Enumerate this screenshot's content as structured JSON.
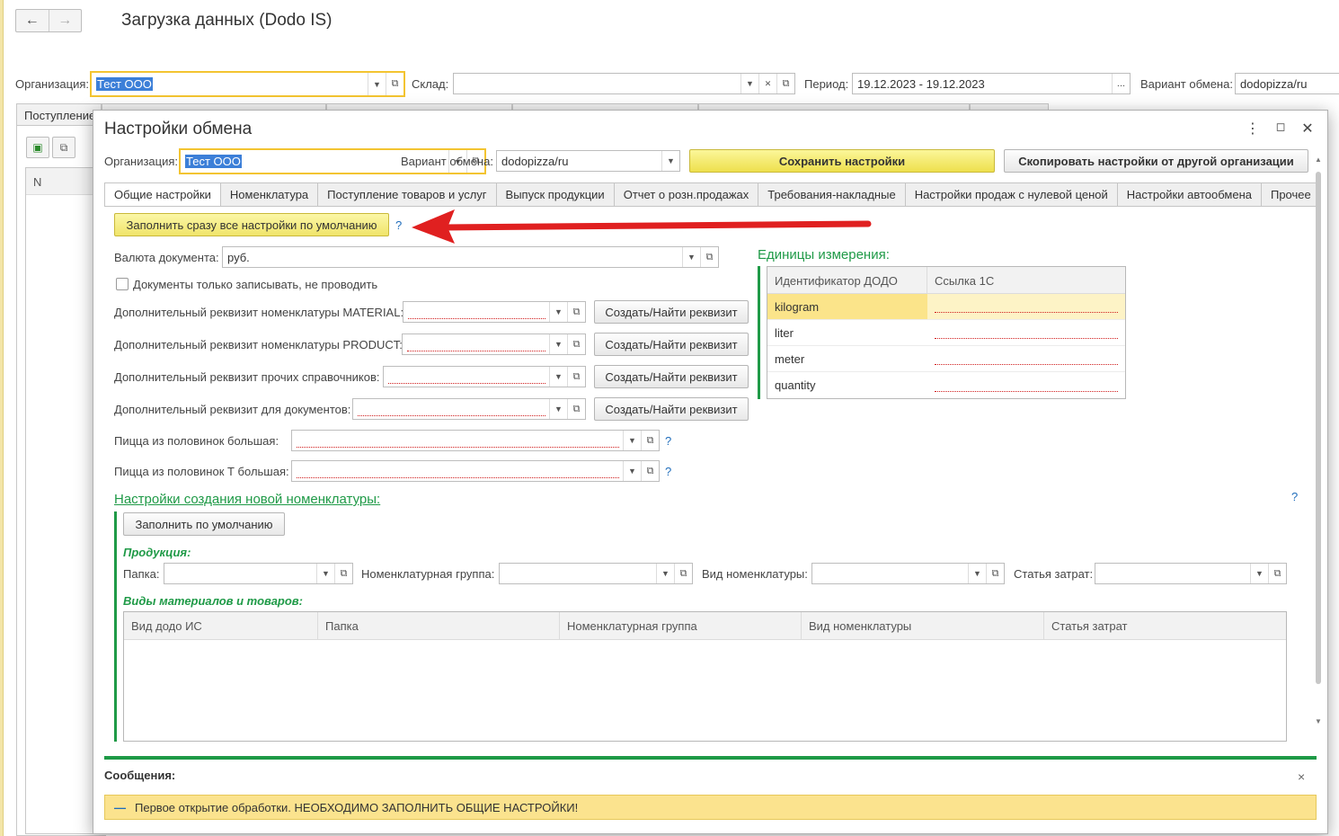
{
  "colors": {
    "accent_green": "#1f9a47",
    "focus_yellow": "#f3c431",
    "message_bg": "#fbe38e",
    "arrow_red": "#e02020",
    "selection_blue": "#3c7fd8"
  },
  "background": {
    "title": "Загрузка данных (Dodo IS)",
    "org_label": "Организация:",
    "org_value": "Тест ООО",
    "warehouse_label": "Склад:",
    "warehouse_value": "",
    "period_label": "Период:",
    "period_value": "19.12.2023 - 19.12.2023",
    "variant_label": "Вариант обмена:",
    "variant_value": "dodopizza/ru",
    "tab_first": "Поступление",
    "grid_col": "N"
  },
  "modal": {
    "title": "Настройки обмена",
    "org_label": "Организация:",
    "org_value": "Тест ООО",
    "variant_label": "Вариант обмена:",
    "variant_value": "dodopizza/ru",
    "save_btn": "Сохранить настройки",
    "copy_btn": "Скопировать настройки от другой организации",
    "tabs": [
      "Общие настройки",
      "Номенклатура",
      "Поступление товаров и услуг",
      "Выпуск продукции",
      "Отчет о розн.продажах",
      "Требования-накладные",
      "Настройки продаж с нулевой ценой",
      "Настройки автообмена",
      "Прочее"
    ],
    "fill_all_btn": "Заполнить сразу все настройки по умолчанию",
    "help": "?",
    "currency_label": "Валюта документа:",
    "currency_value": "руб.",
    "only_write_label": "Документы только записывать, не проводить",
    "extra_rows": [
      {
        "label": "Дополнительный реквизит номенклатуры MATERIAL:",
        "button": "Создать/Найти реквизит"
      },
      {
        "label": "Дополнительный реквизит номенклатуры PRODUCT:",
        "button": "Создать/Найти реквизит"
      },
      {
        "label": "Дополнительный реквизит прочих справочников:",
        "button": "Создать/Найти реквизит"
      },
      {
        "label": "Дополнительный реквизит для документов:",
        "button": "Создать/Найти реквизит"
      }
    ],
    "pizza_half_big_label": "Пицца из половинок большая:",
    "pizza_half_t_big_label": "Пицца из половинок Т большая:",
    "units_title": "Единицы измерения:",
    "units_headers": [
      "Идентификатор ДОДО",
      "Ссылка 1С"
    ],
    "units_rows": [
      "kilogram",
      "liter",
      "meter",
      "quantity"
    ],
    "new_nom_title": "Настройки создания новой номенклатуры:",
    "fill_default_btn": "Заполнить по умолчанию",
    "production_label": "Продукция:",
    "folder_label": "Папка:",
    "nom_group_label": "Номенклатурная группа:",
    "nom_kind_label": "Вид номенклатуры:",
    "cost_item_label": "Статья затрат:",
    "materials_label": "Виды материалов и товаров:",
    "materials_headers": [
      "Вид додо ИС",
      "Папка",
      "Номенклатурная группа",
      "Вид номенклатуры",
      "Статья затрат"
    ]
  },
  "messages": {
    "title": "Сообщения:",
    "close": "×",
    "text": "Первое открытие обработки. НЕОБХОДИМО ЗАПОЛНИТЬ ОБЩИЕ НАСТРОЙКИ!"
  }
}
